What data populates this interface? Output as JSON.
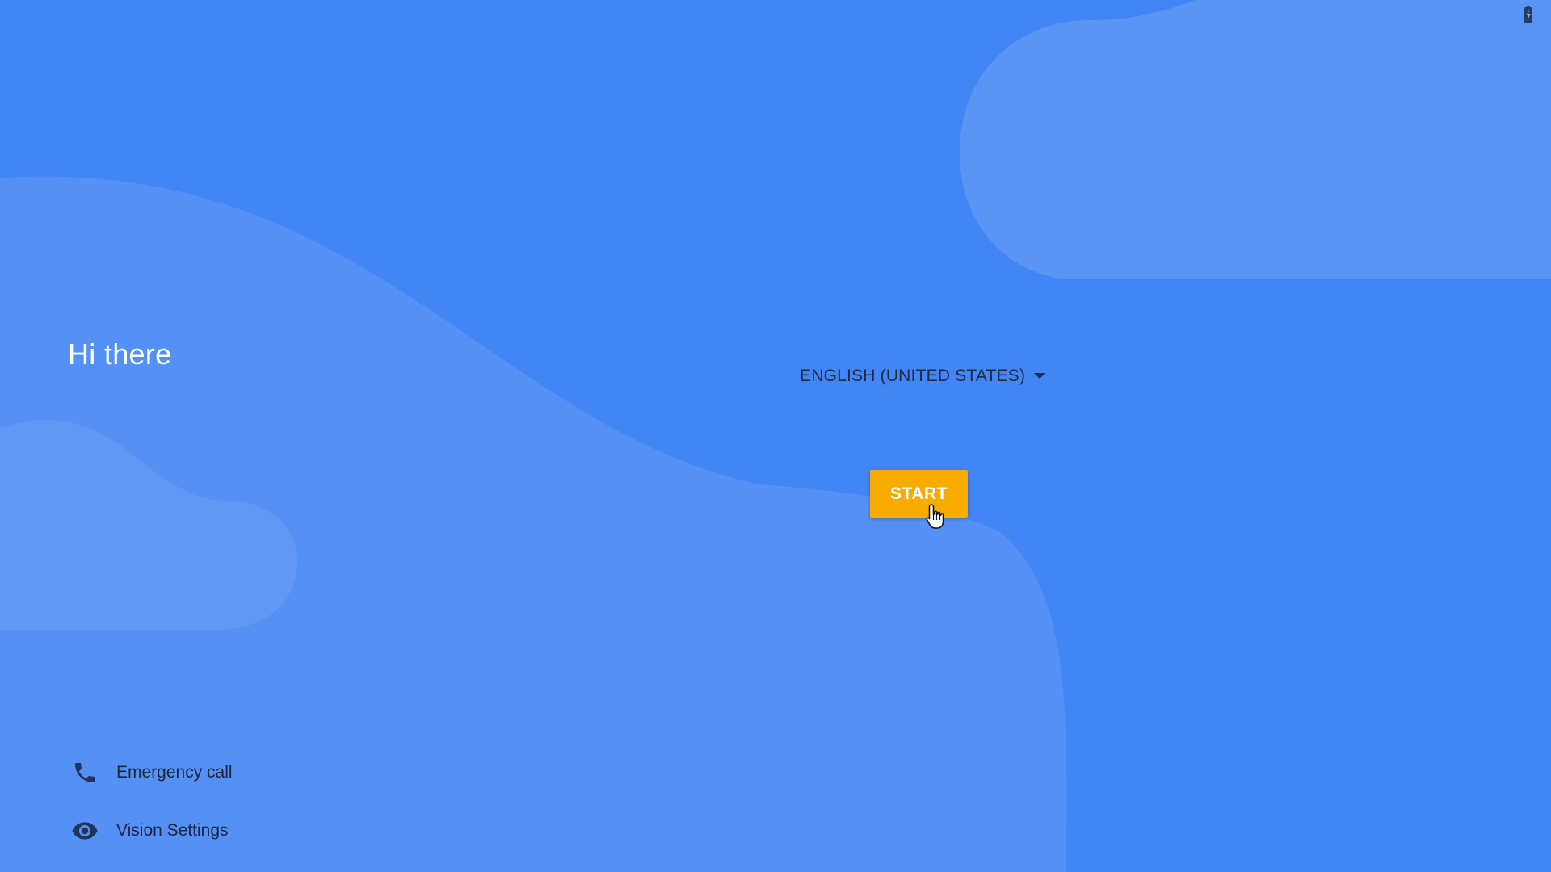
{
  "screen": {
    "greeting": "Hi there",
    "language": {
      "selected_label": "ENGLISH (UNITED STATES)",
      "icon": "dropdown-caret-icon"
    },
    "start_button": {
      "label": "START"
    },
    "links": {
      "emergency_call": {
        "label": "Emergency call",
        "icon": "phone-icon"
      },
      "vision_settings": {
        "label": "Vision Settings",
        "icon": "eye-icon"
      }
    },
    "status_bar": {
      "icon": "battery-charging-icon"
    }
  },
  "colors": {
    "background": "#4285f4",
    "accent_button": "#f9ab00",
    "text_dark": "#1c2540",
    "text_light": "#ffffff"
  }
}
